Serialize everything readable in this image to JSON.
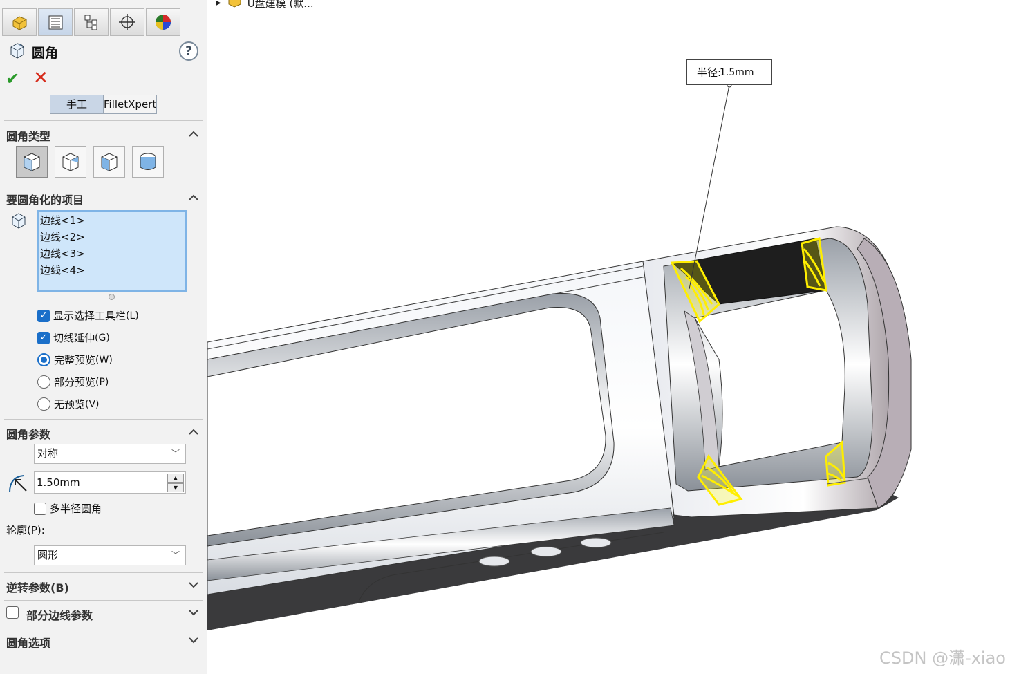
{
  "feature": {
    "title": "圆角",
    "help": "?"
  },
  "tabs": [
    "feature-manager-icon",
    "property-manager-icon",
    "configuration-manager-icon",
    "dimxpert-icon",
    "display-manager-icon"
  ],
  "mode": {
    "manual": "手工",
    "expert": "FilletXpert"
  },
  "fillet_type": {
    "title": "圆角类型",
    "selected_index": 0
  },
  "items": {
    "title": "要圆角化的项目",
    "edges": [
      "边线<1>",
      "边线<2>",
      "边线<3>",
      "边线<4>"
    ]
  },
  "options": {
    "show_toolbar": {
      "label": "显示选择工具栏",
      "key": "(L)",
      "checked": true
    },
    "tangent": {
      "label": "切线延伸",
      "key": "(G)",
      "checked": true
    },
    "full_preview": {
      "label": "完整预览",
      "key": "(W)",
      "selected": true
    },
    "partial_preview": {
      "label": "部分预览",
      "key": "(P)",
      "selected": false
    },
    "no_preview": {
      "label": "无预览",
      "key": "(V)",
      "selected": false
    }
  },
  "params": {
    "title": "圆角参数",
    "method": "对称",
    "radius": "1.50mm",
    "multi_radius": "多半径圆角",
    "profile_label": "轮廓(P):",
    "profile": "圆形"
  },
  "sections": {
    "reverse": "逆转参数(B)",
    "partial_edge": "部分边线参数",
    "fillet_options": "圆角选项"
  },
  "tree": {
    "label": "U盘建模 (默..."
  },
  "callout": {
    "label": "半径:",
    "value": "1.5mm"
  },
  "watermark": "CSDN @潇-xiao",
  "colors": {
    "accent": "#1a6fc9",
    "highlight": "#ffff00",
    "list_bg": "#cfe6fa"
  }
}
